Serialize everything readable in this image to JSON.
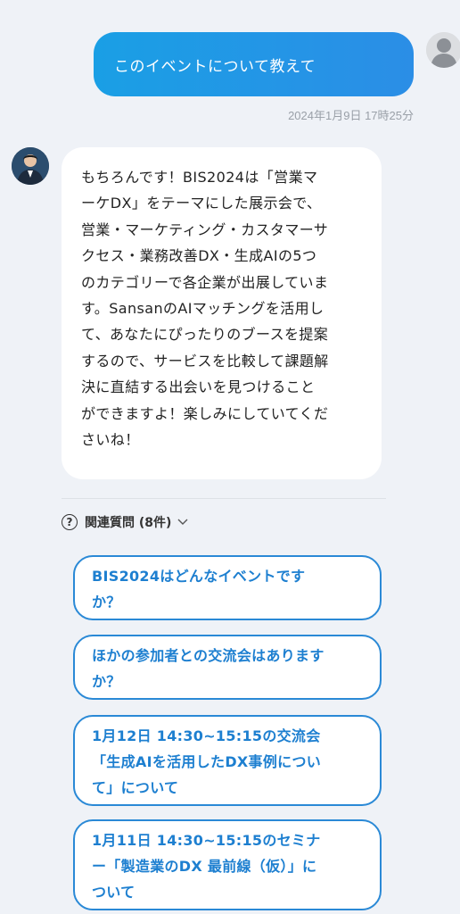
{
  "user_message": {
    "text": "このイベントについて教えて",
    "timestamp": "2024年1月9日 17時25分"
  },
  "bot_message": {
    "text": "もちろんです！BIS2024は「営業マ\nーケDX」をテーマにした展示会で、\n営業・マーケティング・カスタマーサ\nクセス・業務改善DX・生成AIの5つ\nのカテゴリーで各企業が出展していま\nす。SansanのAIマッチングを活用し\nて、あなたにぴったりのブースを提案\nするので、サービスを比較して課題解\n決に直結する出会いを見つけること\nができますよ！楽しみにしていてくだ\nさいね！"
  },
  "related": {
    "question_icon": "?",
    "label": "関連質問 (8件)",
    "chevron_icon": "chevron-down-icon",
    "questions": [
      {
        "label": "BIS2024はどんなイベントです\nか？"
      },
      {
        "label": "ほかの参加者との交流会はあります\nか？"
      },
      {
        "label": "1月12日 14:30~15:15の交流会\n「生成AIを活用したDX事例につい\nて」について"
      },
      {
        "label": "1月11日 14:30~15:15のセミナ\nー「製造業のDX 最前線（仮）」に\nついて"
      }
    ]
  },
  "colors": {
    "accent": "#1d7fd0",
    "user_bubble": "#1a9fe5",
    "background": "#eff2f7"
  }
}
